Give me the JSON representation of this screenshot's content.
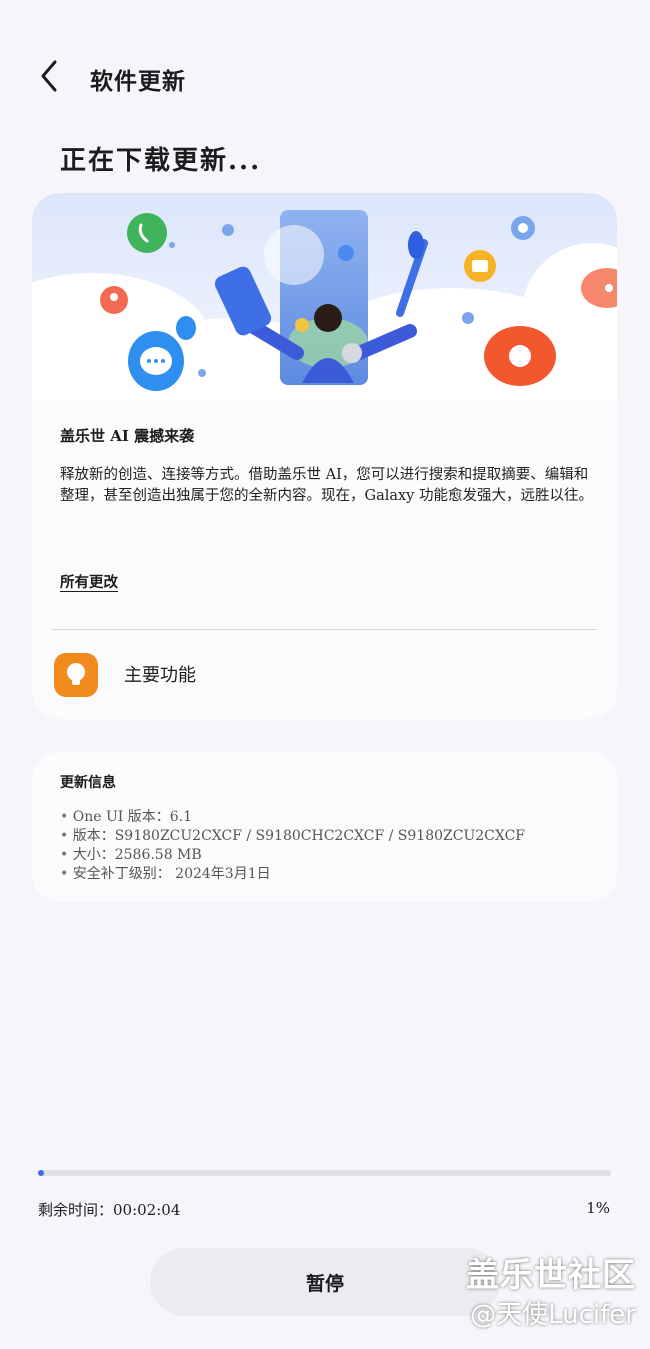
{
  "header": {
    "title": "软件更新",
    "back_icon": "chevron-left-icon"
  },
  "status_heading": "正在下载更新...",
  "card": {
    "ai_title": "盖乐世 AI 震撼来袭",
    "description": "释放新的创造、连接等方式。借助盖乐世 AI，您可以进行搜索和提取摘要、编辑和整理，甚至创造出独属于您的全新内容。现在，Galaxy 功能愈发强大，远胜以往。",
    "all_changes": "所有更改",
    "feature": {
      "label": "主要功能",
      "icon": "lightbulb-icon",
      "icon_color": "#f08a1c"
    }
  },
  "info": {
    "title": "更新信息",
    "items": [
      "One UI 版本：6.1",
      "版本：S9180ZCU2CXCF / S9180CHC2CXCF / S9180ZCU2CXCF",
      "大小：2586.58 MB",
      "安全补丁级别： 2024年3月1日"
    ]
  },
  "progress": {
    "remaining": "剩余时间：00:02:04",
    "percent": "1%",
    "value": 0.01,
    "color": "#3a6ee8"
  },
  "pause_button": "暂停",
  "watermark": {
    "line1": "盖乐世社区",
    "line2": "@天使Lucifer"
  }
}
